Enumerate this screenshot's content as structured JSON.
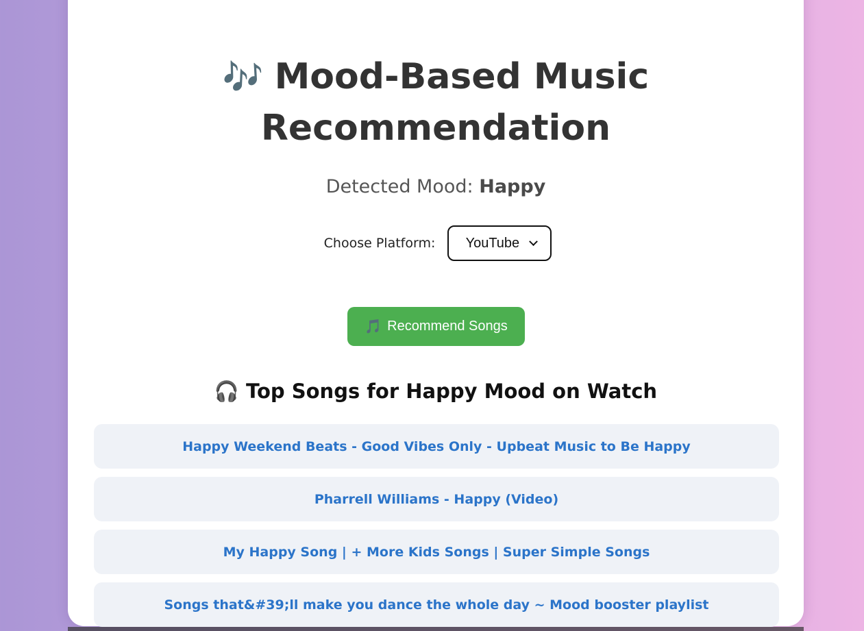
{
  "header": {
    "title_icon": "🎶",
    "title_line1": "Mood-Based Music",
    "title_line2": "Recommendation"
  },
  "mood": {
    "label": "Detected Mood:",
    "value": "Happy"
  },
  "platform": {
    "label": "Choose Platform:",
    "selected": "YouTube"
  },
  "recommend_button": {
    "icon": "🎵",
    "label": "Recommend Songs"
  },
  "results": {
    "heading_icon": "🎧",
    "heading": "Top Songs for Happy Mood on Watch",
    "songs": [
      {
        "title": "Happy Weekend Beats - Good Vibes Only - Upbeat Music to Be Happy"
      },
      {
        "title": "Pharrell Williams - Happy (Video)"
      },
      {
        "title": "My Happy Song | + More Kids Songs | Super Simple Songs"
      },
      {
        "title": "Songs that&#39;ll make you dance the whole day ~ Mood booster playlist"
      }
    ]
  },
  "colors": {
    "accent_button": "#4caf50",
    "link": "#2b74c9",
    "song_item_bg": "#eff2f7"
  }
}
